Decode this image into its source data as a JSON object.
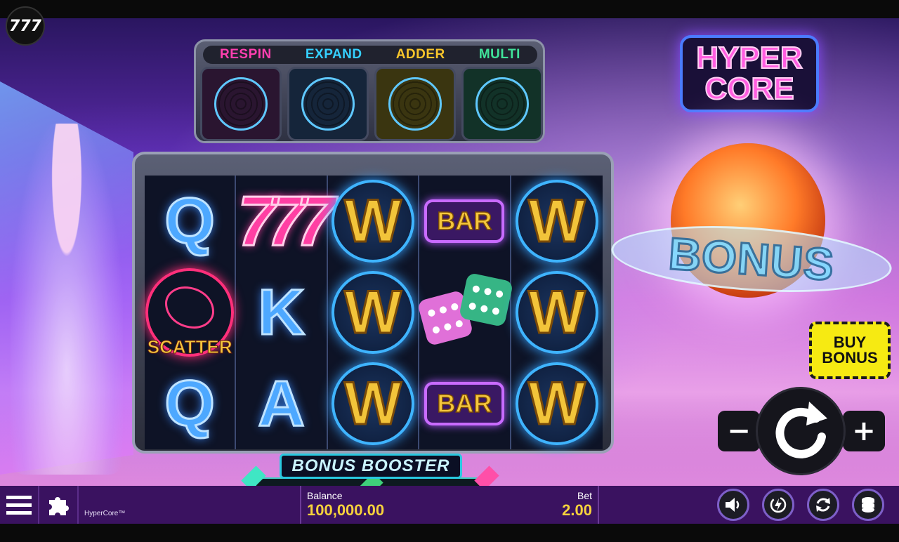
{
  "brand": {
    "badge": "777"
  },
  "game": {
    "title_line1": "HYPER",
    "title_line2": "CORE",
    "name": "HyperCore™"
  },
  "modifiers": [
    {
      "label": "RESPIN",
      "color": "#ff3fb0"
    },
    {
      "label": "EXPAND",
      "color": "#35d0ff"
    },
    {
      "label": "ADDER",
      "color": "#f7c52b"
    },
    {
      "label": "MULTI",
      "color": "#40e39a"
    }
  ],
  "reels": {
    "grid": [
      [
        "Q",
        "777",
        "W",
        "BAR",
        "W"
      ],
      [
        "SCATTER",
        "K",
        "W",
        "DICE",
        "W"
      ],
      [
        "Q",
        "A",
        "W",
        "BAR",
        "W"
      ]
    ]
  },
  "booster": {
    "label": "BONUS BOOSTER"
  },
  "bonus": {
    "label": "BONUS"
  },
  "buy_bonus": {
    "line1": "BUY",
    "line2": "BONUS"
  },
  "controls": {
    "minus": "−",
    "plus": "+",
    "spin_icon": "spin-arrow-icon"
  },
  "footer": {
    "balance_label": "Balance",
    "balance_value": "100,000.00",
    "bet_label": "Bet",
    "bet_value": "2.00",
    "icons": [
      "menu-icon",
      "puzzle-icon",
      "volume-icon",
      "turbo-icon",
      "autoplay-icon",
      "coins-icon"
    ]
  },
  "colors": {
    "accent": "#f7d23c",
    "bar_bg": "#3a1260",
    "buy_bonus": "#f6ea12"
  }
}
